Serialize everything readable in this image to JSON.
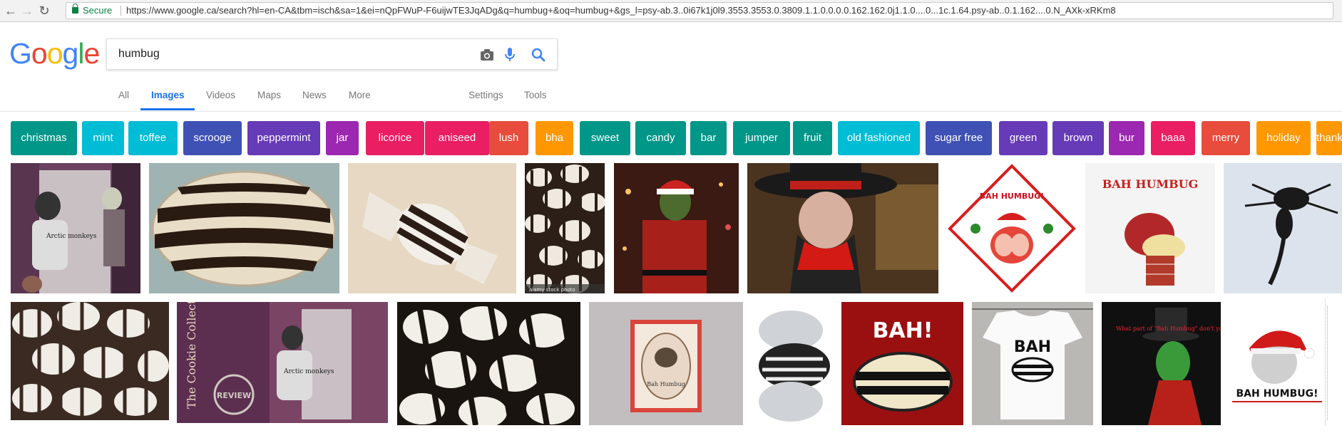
{
  "browser": {
    "back_icon": "arrow-left-icon",
    "forward_icon": "arrow-right-icon",
    "reload_icon": "reload-icon",
    "secure_label": "Secure",
    "url": "https://www.google.ca/search?hl=en-CA&tbm=isch&sa=1&ei=nQpFWuP-F6uijwTE3JqADg&q=humbug+&oq=humbug+&gs_l=psy-ab.3..0i67k1j0l9.3553.3553.0.3809.1.1.0.0.0.0.162.162.0j1.1.0....0...1c.1.64.psy-ab..0.1.162....0.N_AXk-xRKm8"
  },
  "logo": {
    "letters": [
      "G",
      "o",
      "o",
      "g",
      "l",
      "e"
    ],
    "colors": [
      "#4285f4",
      "#ea4335",
      "#fbbc05",
      "#4285f4",
      "#34a853",
      "#ea4335"
    ]
  },
  "search": {
    "query": "humbug",
    "camera_icon": "camera-icon",
    "mic_icon": "microphone-icon",
    "search_icon": "search-icon"
  },
  "tabs": {
    "all": "All",
    "images": "Images",
    "videos": "Videos",
    "maps": "Maps",
    "news": "News",
    "more": "More",
    "settings": "Settings",
    "tools": "Tools"
  },
  "chips": [
    {
      "label": "christmas",
      "color": "#009688"
    },
    {
      "label": "mint",
      "color": "#00bcd4"
    },
    {
      "label": "toffee",
      "color": "#00bcd4"
    },
    {
      "label": "scrooge",
      "color": "#3f51b5"
    },
    {
      "label": "peppermint",
      "color": "#673ab7"
    },
    {
      "label": "jar",
      "color": "#9c27b0"
    },
    {
      "label": "licorice",
      "color": "#e91e63"
    },
    {
      "label": "aniseed",
      "color": "#e91e63"
    },
    {
      "label": "lush",
      "color": "#e74c3c"
    },
    {
      "label": "bha",
      "color": "#ff9800"
    },
    {
      "label": "sweet",
      "color": "#009688"
    },
    {
      "label": "candy",
      "color": "#009688"
    },
    {
      "label": "bar",
      "color": "#009688"
    },
    {
      "label": "jumper",
      "color": "#009688"
    },
    {
      "label": "fruit",
      "color": "#009688"
    },
    {
      "label": "old fashioned",
      "color": "#00bcd4"
    },
    {
      "label": "sugar free",
      "color": "#3f51b5"
    },
    {
      "label": "green",
      "color": "#673ab7"
    },
    {
      "label": "brown",
      "color": "#673ab7"
    },
    {
      "label": "bur",
      "color": "#9c27b0"
    },
    {
      "label": "baaa",
      "color": "#e91e63"
    },
    {
      "label": "merry",
      "color": "#e74c3c"
    },
    {
      "label": "holiday",
      "color": "#ff9800"
    },
    {
      "label": "thank",
      "color": "#ff9800"
    }
  ],
  "image_texts": {
    "am1_text": "Arctic monkeys",
    "bah_humbug_sign": "BAH HUMBUG!",
    "bah_humbug_cartoon": "BAH HUMBUG",
    "alamy": "alamy stock photo",
    "cookie_title": "The Cookie Collector",
    "cookie_badge": "REVIEW",
    "am2_text": "Arctic monkeys",
    "card_text": "Bah Humbug",
    "bah1": "BAH!",
    "bah2": "BAH",
    "scrooge_text": "What part of \"Bah Humbug\" don't you understand?",
    "bah3": "BAH HUMBUG!"
  }
}
